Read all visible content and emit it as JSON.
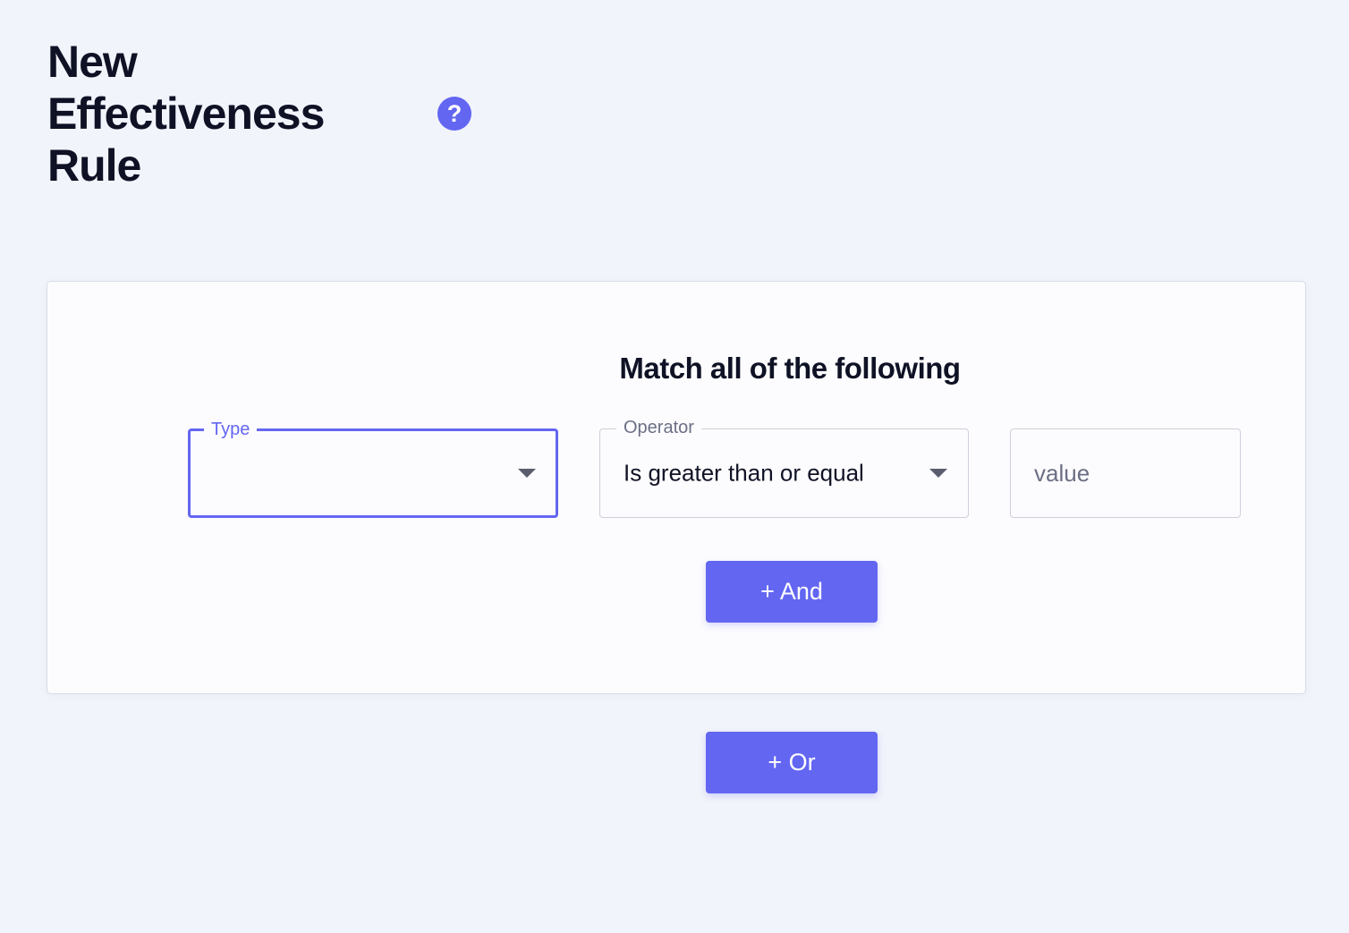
{
  "header": {
    "title": "New Effectiveness Rule",
    "help_label": "?"
  },
  "rule_group": {
    "heading": "Match all of the following",
    "condition": {
      "type": {
        "label": "Type",
        "value": ""
      },
      "operator": {
        "label": "Operator",
        "value": "Is greater than or equal"
      },
      "value": {
        "placeholder": "value",
        "current": ""
      }
    },
    "and_button_label": "+ And"
  },
  "or_button_label": "+ Or",
  "colors": {
    "accent": "#6366f1",
    "background": "#f2f4fb",
    "card": "#fcfcfe",
    "text": "#0f1225"
  }
}
